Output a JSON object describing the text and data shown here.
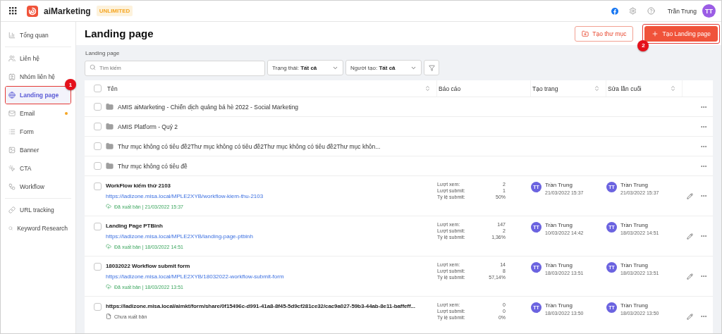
{
  "topbar": {
    "brand": "aiMarketing",
    "plan": "UNLIMITED",
    "user": "Trần Trung",
    "avatar": "TT"
  },
  "sidebar": {
    "groups": [
      {
        "items": [
          {
            "label": "Tổng quan",
            "selected": false,
            "dot": false
          }
        ]
      },
      {
        "items": [
          {
            "label": "Liên hệ",
            "selected": false,
            "dot": false
          },
          {
            "label": "Nhóm liên hệ",
            "selected": false,
            "dot": false
          },
          {
            "label": "Landing page",
            "selected": true,
            "dot": false,
            "callout": "1"
          },
          {
            "label": "Email",
            "selected": false,
            "dot": true
          },
          {
            "label": "Form",
            "selected": false,
            "dot": false
          },
          {
            "label": "Banner",
            "selected": false,
            "dot": false
          },
          {
            "label": "CTA",
            "selected": false,
            "dot": false
          },
          {
            "label": "Workflow",
            "selected": false,
            "dot": false
          }
        ]
      },
      {
        "items": [
          {
            "label": "URL tracking",
            "selected": false,
            "dot": false
          },
          {
            "label": "Keyword Research",
            "selected": false,
            "dot": false
          }
        ]
      }
    ]
  },
  "page": {
    "title": "Landing page",
    "breadcrumb": "Landing page",
    "buttons": [
      {
        "kind": "secondary",
        "label": "Tạo thư mục"
      },
      {
        "kind": "primary",
        "label": "Tạo Landing page",
        "callout": "2"
      }
    ]
  },
  "filters": {
    "search": {
      "placeholder": "Tìm kiếm"
    },
    "selects": [
      {
        "label": "Trạng thái:",
        "value": "Tất cả"
      },
      {
        "label": "Người tạo:",
        "value": "Tất cả"
      }
    ]
  },
  "table": {
    "select_all": {
      "checked": false
    },
    "columns": [
      {
        "label": "Tên",
        "sortable": true
      },
      {
        "label": "Báo cáo",
        "sortable": false
      },
      {
        "label": "Tạo trang",
        "sortable": true
      },
      {
        "label": "Sửa lần cuối",
        "sortable": true
      }
    ],
    "rows": [
      {
        "kind": "folder",
        "checked": false,
        "name": "AMIS aiMarketing - Chiến dịch quảng bá hè 2022 - Social Marketing"
      },
      {
        "kind": "folder",
        "checked": false,
        "name": "AMIS Platform - Quý 2"
      },
      {
        "kind": "folder",
        "checked": false,
        "name": "Thư mục không có tiêu đề2Thư mục không có tiêu đề2Thư mục không có tiêu đề2Thư mục khôn..."
      },
      {
        "kind": "folder",
        "checked": false,
        "name": "Thư mục không có tiêu đề"
      },
      {
        "kind": "page",
        "checked": false,
        "name": "WorkFlow kiểm thử 2103",
        "url": "https://ladizone.misa.local/MPLE2XYB/workflow-kiem-thu-2103",
        "published": true,
        "status": "Đã xuất bản | 21/03/2022 15:37",
        "stats": [
          {
            "label": "Lượt xem:",
            "value": "2"
          },
          {
            "label": "Lượt submit:",
            "value": "1"
          },
          {
            "label": "Tỷ lệ submit:",
            "value": "50%"
          }
        ],
        "created": {
          "avatar": "TT",
          "user": "Trần Trung",
          "time": "21/03/2022 15:37"
        },
        "modified": {
          "avatar": "TT",
          "user": "Trần Trung",
          "time": "21/03/2022 15:37"
        }
      },
      {
        "kind": "page",
        "checked": false,
        "name": "Landing Page PTBinh",
        "url": "https://ladizone.misa.local/MPLE2XYB/landing-page-ptbinh",
        "published": true,
        "status": "Đã xuất bản | 18/03/2022 14:51",
        "stats": [
          {
            "label": "Lượt xem:",
            "value": "147"
          },
          {
            "label": "Lượt submit:",
            "value": "2"
          },
          {
            "label": "Tỷ lệ submit:",
            "value": "1,36%"
          }
        ],
        "created": {
          "avatar": "TT",
          "user": "Trần Trung",
          "time": "10/03/2022 14:42"
        },
        "modified": {
          "avatar": "TT",
          "user": "Trần Trung",
          "time": "18/03/2022 14:51"
        }
      },
      {
        "kind": "page",
        "checked": false,
        "name": "18032022 Workflow submit form",
        "url": "https://ladizone.misa.local/MPLE2XYB/18032022-workflow-submit-form",
        "published": true,
        "status": "Đã xuất bản | 18/03/2022 13:51",
        "stats": [
          {
            "label": "Lượt xem:",
            "value": "14"
          },
          {
            "label": "Lượt submit:",
            "value": "8"
          },
          {
            "label": "Tỷ lệ submit:",
            "value": "57,14%"
          }
        ],
        "created": {
          "avatar": "TT",
          "user": "Trần Trung",
          "time": "18/03/2022 13:51"
        },
        "modified": {
          "avatar": "TT",
          "user": "Trần Trung",
          "time": "18/03/2022 13:51"
        }
      },
      {
        "kind": "page",
        "checked": false,
        "name": "https://ladizone.misa.local/aimkt/form/share/0f15496c-d991-41a8-8f45-5d9cf281ce32/cac9a027-59b3-44ab-8e11-baffeff...",
        "published": false,
        "status": "Chưa xuất bản",
        "stats": [
          {
            "label": "Lượt xem:",
            "value": "0"
          },
          {
            "label": "Lượt submit:",
            "value": "0"
          },
          {
            "label": "Tỷ lệ submit:",
            "value": "0%"
          }
        ],
        "created": {
          "avatar": "TT",
          "user": "Trần Trung",
          "time": "18/03/2022 13:50"
        },
        "modified": {
          "avatar": "TT",
          "user": "Trần Trung",
          "time": "18/03/2022 13:50"
        }
      }
    ]
  }
}
